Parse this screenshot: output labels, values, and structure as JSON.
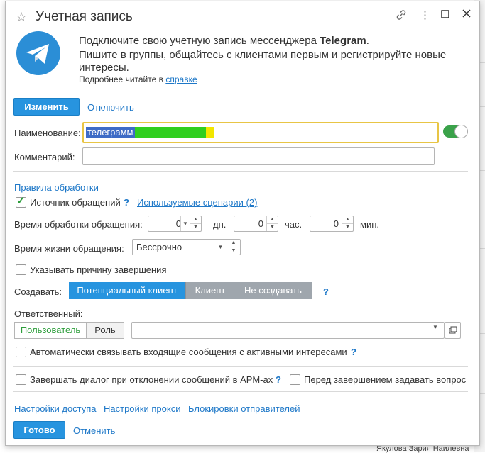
{
  "window": {
    "title": "Учетная  запись"
  },
  "header": {
    "line1_prefix": "Подключите свою учетную запись мессенджера ",
    "line1_bold": "Telegram",
    "line1_suffix": ".",
    "line2": "Пишите в группы, общайтесь с клиентами первым и регистрируйте новые интересы.",
    "line3_prefix": "Подробнее читайте в ",
    "line3_link": "справке"
  },
  "toolbar": {
    "change_label": "Изменить",
    "disconnect_label": "Отключить"
  },
  "form": {
    "name_label": "Наименование:",
    "name_value": "телеграмм",
    "comment_label": "Комментарий:",
    "comment_value": ""
  },
  "rules": {
    "section_title": "Правила обработки",
    "source_label": "Источник обращений",
    "source_checked": true,
    "scenarios_link": "Используемые сценарии (2)",
    "processing_label": "Время обработки обращения:",
    "days_value": "0",
    "days_unit": "дн.",
    "hours_value": "0",
    "hours_unit": "час.",
    "minutes_value": "0",
    "minutes_unit": "мин.",
    "lifetime_label": "Время жизни обращения:",
    "lifetime_value": "Бессрочно",
    "reason_label": "Указывать причину завершения",
    "create_label": "Создавать:",
    "create_options": [
      "Потенциальный клиент",
      "Клиент",
      "Не создавать"
    ],
    "create_selected": "Потенциальный клиент",
    "responsible_label": "Ответственный:",
    "responsible_tabs": [
      "Пользователь",
      "Роль"
    ],
    "responsible_value": "",
    "autolink_label": "Автоматически связывать входящие сообщения с активными интересами",
    "finish_dialog_label": "Завершать диалог при отклонении сообщений в АРМ-ах",
    "ask_question_label": "Перед завершением задавать вопрос"
  },
  "footer": {
    "links": [
      "Настройки доступа",
      "Настройки прокси",
      "Блокировки отправителей"
    ],
    "ok_label": "Готово",
    "cancel_label": "Отменить"
  },
  "background": {
    "bottom_text": "Якулова Зария Наилевна"
  },
  "colors": {
    "accent": "#2794df",
    "link": "#1e78c8",
    "toggle_on": "#3aa24a",
    "focus_border": "#e8c545"
  }
}
